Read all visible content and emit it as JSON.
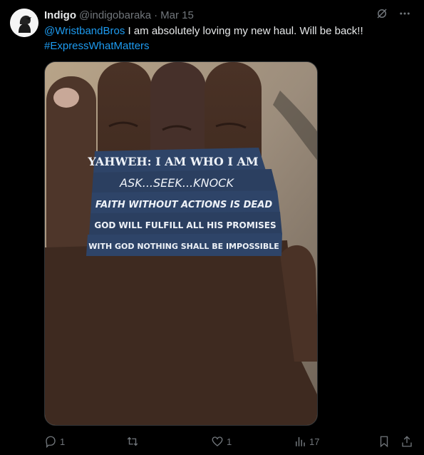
{
  "author": {
    "name": "Indigo",
    "handle": "@indigobaraka",
    "separator": "·",
    "date": "Mar 15"
  },
  "tweet": {
    "mention": "@WristbandBros",
    "body": " I am absolutely loving my new haul. Will be back!!",
    "hashtag": "#ExpressWhatMatters"
  },
  "wristbands": [
    "YAHWEH: I AM WHO I AM",
    "ASK...SEEK...KNOCK",
    "FAITH WITHOUT ACTIONS IS DEAD",
    "GOD WILL FULFILL ALL HIS PROMISES",
    "WITH GOD NOTHING SHALL BE IMPOSSIBLE"
  ],
  "actions": {
    "replies": "1",
    "likes": "1",
    "views": "17"
  },
  "icons": [
    "grok-icon",
    "more-icon",
    "reply-icon",
    "retweet-icon",
    "like-icon",
    "views-icon",
    "bookmark-icon",
    "share-icon"
  ],
  "colors": {
    "accent": "#1d9bf0",
    "muted": "#71767b",
    "text": "#e7e9ea",
    "band": "#2e4468"
  }
}
